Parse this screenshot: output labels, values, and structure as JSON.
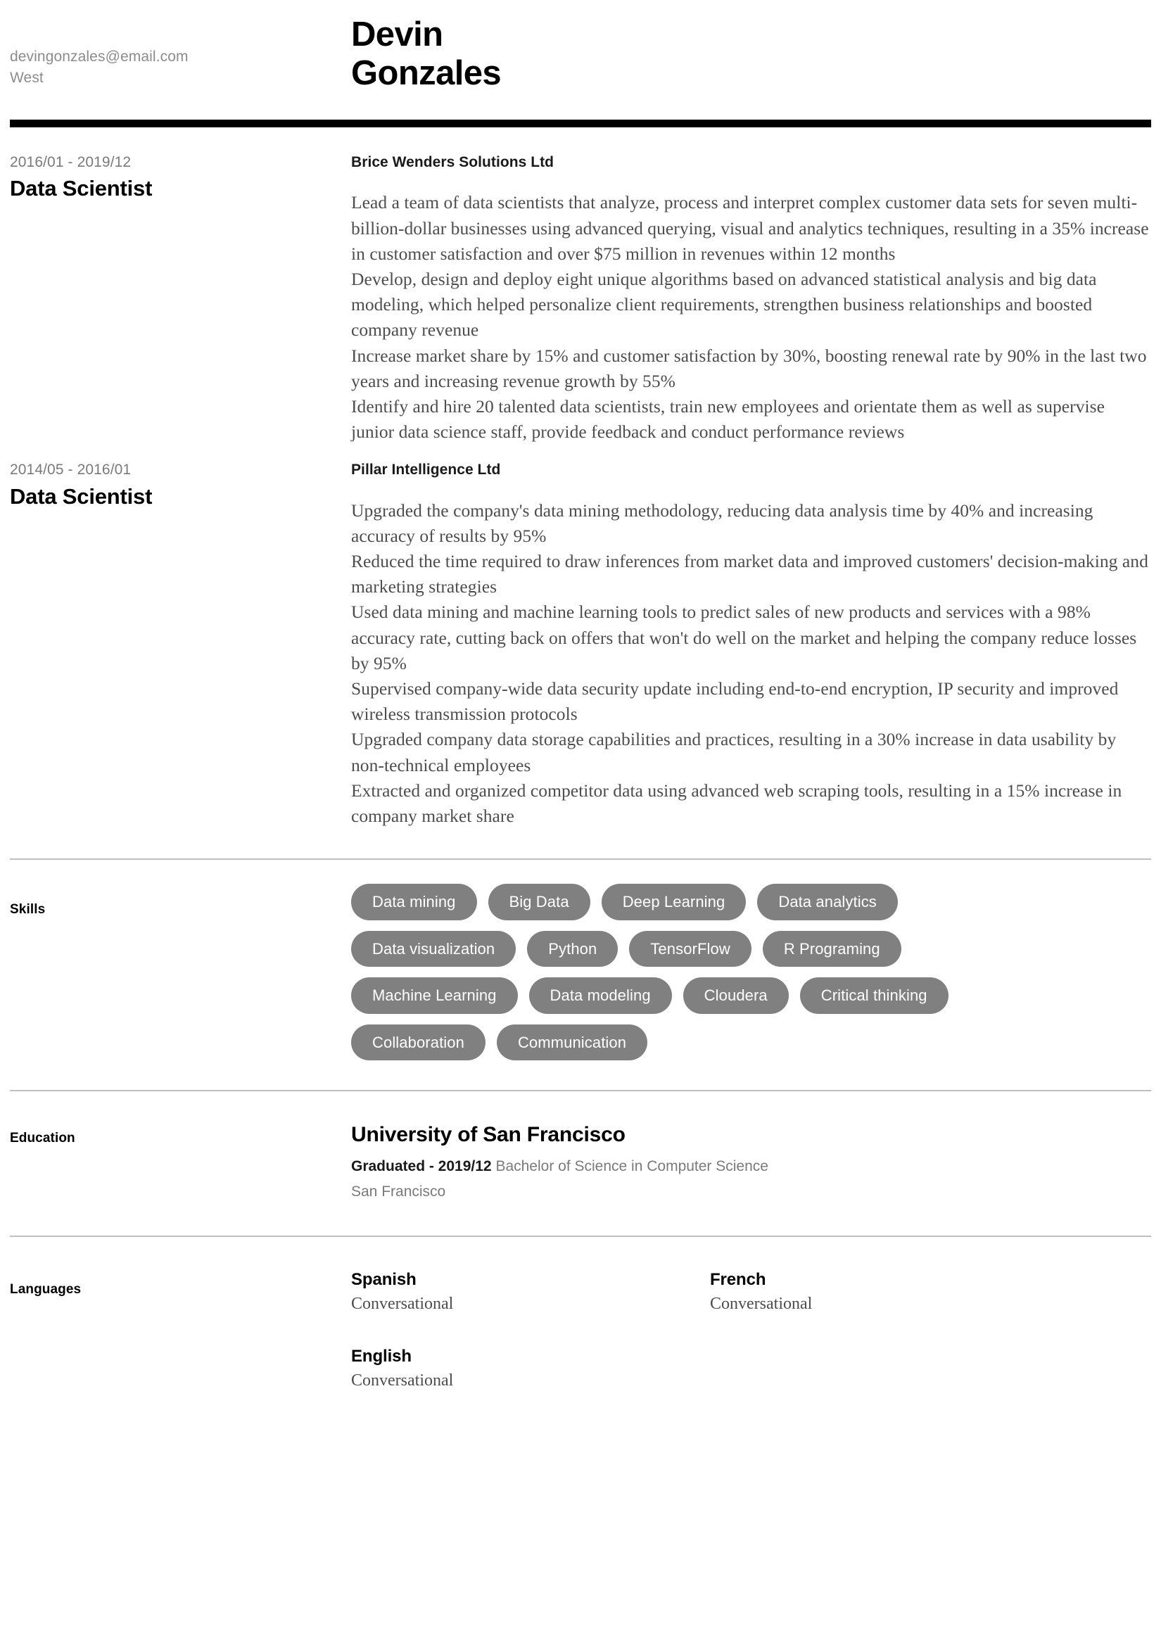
{
  "header": {
    "first_name": "Devin",
    "last_name": "Gonzales",
    "email": "devingonzales@email.com",
    "location": "West"
  },
  "experience": {
    "items": [
      {
        "dates": "2016/01 - 2019/12",
        "title": "Data Scientist",
        "company": "Brice Wenders Solutions Ltd",
        "bullets": [
          "Lead a team of data scientists that analyze, process and interpret complex customer data sets for seven multi-billion-dollar businesses using advanced querying, visual and analytics techniques, resulting in a 35% increase in customer satisfaction and over $75 million in revenues within 12 months",
          "Develop, design and deploy eight unique algorithms based on advanced statistical analysis and big data modeling, which helped personalize client requirements, strengthen business relationships and boosted company revenue",
          "Increase market share by 15% and customer satisfaction by 30%, boosting renewal rate by 90% in the last two years and increasing revenue growth by 55%",
          "Identify and hire 20 talented data scientists, train new employees and orientate them as well as supervise junior data science staff, provide feedback and conduct performance reviews"
        ]
      },
      {
        "dates": "2014/05 - 2016/01",
        "title": "Data Scientist",
        "company": "Pillar Intelligence Ltd",
        "bullets": [
          "Upgraded the company's data mining methodology, reducing data analysis time by 40% and increasing accuracy of results by 95%",
          "Reduced the time required to draw inferences from market data and improved customers' decision-making and marketing strategies",
          "Used data mining and machine learning tools to predict sales of new products and services with a 98% accuracy rate, cutting back on offers that won't do well on the market and helping the company reduce losses by 95%",
          "Supervised company-wide data security update including end-to-end encryption, IP security and improved wireless transmission protocols",
          "Upgraded company data storage capabilities and practices, resulting in a 30% increase in data usability by non-technical employees",
          "Extracted and organized competitor data using advanced web scraping tools, resulting in a 15% increase in company market share"
        ]
      }
    ]
  },
  "skills": {
    "label": "Skills",
    "items": [
      "Data mining",
      "Big Data",
      "Deep Learning",
      "Data analytics",
      "Data visualization",
      "Python",
      "TensorFlow",
      "R Programing",
      "Machine Learning",
      "Data modeling",
      "Cloudera",
      "Critical thinking",
      "Collaboration",
      "Communication"
    ]
  },
  "education": {
    "label": "Education",
    "school": "University of San Francisco",
    "graduated_label": "Graduated - 2019/12",
    "degree": "Bachelor of Science in Computer Science",
    "city": "San Francisco"
  },
  "languages": {
    "label": "Languages",
    "items": [
      {
        "name": "Spanish",
        "level": "Conversational"
      },
      {
        "name": "French",
        "level": "Conversational"
      },
      {
        "name": "English",
        "level": "Conversational"
      }
    ]
  },
  "colors": {
    "accent_bar": "#000000",
    "pill_background": "#808080",
    "pill_text": "#ffffff",
    "muted_text": "#7a7a7a",
    "body_text": "#4d4d4d",
    "divider": "#bfbfbf"
  }
}
